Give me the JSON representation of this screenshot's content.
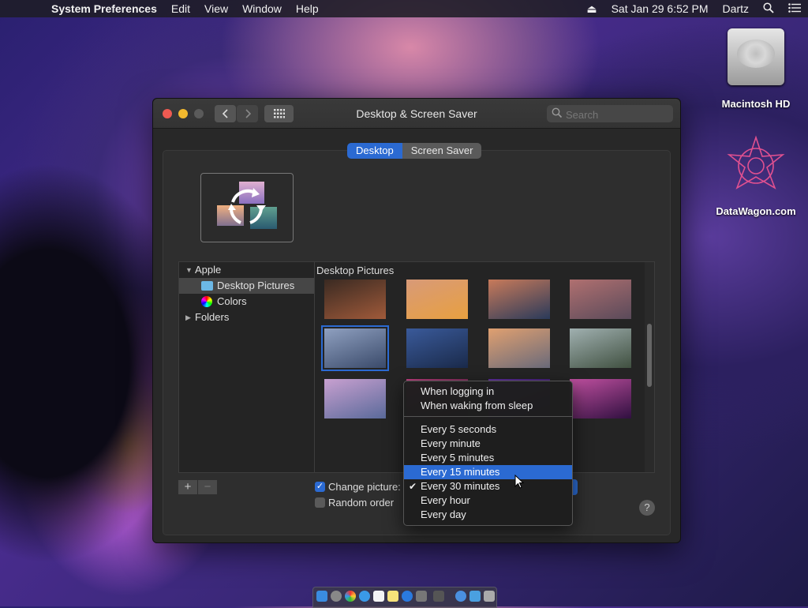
{
  "menubar": {
    "app_name": "System Preferences",
    "menus": [
      "Edit",
      "View",
      "Window",
      "Help"
    ],
    "clock": "Sat Jan 29  6:52 PM",
    "user": "Dartz"
  },
  "desktop": {
    "icons": [
      {
        "label": "Macintosh HD"
      },
      {
        "label": "DataWagon.com"
      }
    ]
  },
  "window": {
    "title": "Desktop & Screen Saver",
    "search_placeholder": "Search",
    "tabs": [
      {
        "label": "Desktop",
        "selected": true
      },
      {
        "label": "Screen Saver",
        "selected": false
      }
    ],
    "sources": {
      "group": "Apple",
      "items": [
        {
          "label": "Desktop Pictures",
          "selected": true,
          "icon": "folder-icon"
        },
        {
          "label": "Colors",
          "selected": false,
          "icon": "colors-icon"
        }
      ],
      "folders": "Folders"
    },
    "grid": {
      "header": "Desktop Pictures",
      "thumbnails": [
        {
          "colors": [
            "#3a2a22",
            "#a05a3a"
          ]
        },
        {
          "colors": [
            "#d89a78",
            "#e8a040"
          ]
        },
        {
          "colors": [
            "#c87a5a",
            "#2a3a5a"
          ]
        },
        {
          "colors": [
            "#b07070",
            "#5a4a5a"
          ]
        },
        {
          "colors": [
            "#8fa0c0",
            "#3a4a6a"
          ],
          "selected": true
        },
        {
          "colors": [
            "#3a5a9a",
            "#1a2a4a"
          ]
        },
        {
          "colors": [
            "#e0a070",
            "#6a6a7a"
          ]
        },
        {
          "colors": [
            "#a0b0b0",
            "#405040"
          ]
        },
        {
          "colors": [
            "#c8a0d0",
            "#5a6a9a"
          ]
        },
        {
          "colors": [
            "#c04080",
            "#1a1020"
          ]
        },
        {
          "colors": [
            "#6030a0",
            "#200a40"
          ]
        },
        {
          "colors": [
            "#c050a0",
            "#301040"
          ]
        }
      ]
    },
    "change_picture": {
      "label": "Change picture:",
      "checked": true
    },
    "random_order": {
      "label": "Random order",
      "checked": false
    },
    "help": "?"
  },
  "interval_menu": {
    "items": [
      {
        "label": "When logging in"
      },
      {
        "label": "When waking from sleep"
      },
      {
        "label": "Every 5 seconds"
      },
      {
        "label": "Every minute"
      },
      {
        "label": "Every 5 minutes"
      },
      {
        "label": "Every 15 minutes",
        "highlighted": true
      },
      {
        "label": "Every 30 minutes",
        "checked": true
      },
      {
        "label": "Every hour"
      },
      {
        "label": "Every day"
      }
    ]
  },
  "colors": {
    "accent": "#2b6ad2",
    "window_bg": "#282828"
  }
}
